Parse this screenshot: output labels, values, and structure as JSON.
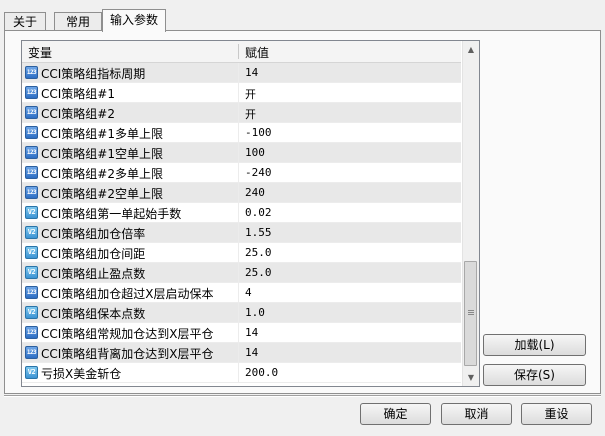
{
  "tabs": [
    {
      "label": "关于"
    },
    {
      "label": "常用"
    },
    {
      "label": "输入参数"
    }
  ],
  "table": {
    "headers": {
      "variable": "变量",
      "value": "赋值"
    },
    "rows": [
      {
        "icon": "123",
        "name": "CCI策略组指标周期",
        "value": "14"
      },
      {
        "icon": "123",
        "name": "CCI策略组#1",
        "value": "开"
      },
      {
        "icon": "123",
        "name": "CCI策略组#2",
        "value": "开"
      },
      {
        "icon": "123",
        "name": "CCI策略组#1多单上限",
        "value": "-100"
      },
      {
        "icon": "123",
        "name": "CCI策略组#1空单上限",
        "value": "100"
      },
      {
        "icon": "123",
        "name": "CCI策略组#2多单上限",
        "value": "-240"
      },
      {
        "icon": "123",
        "name": "CCI策略组#2空单上限",
        "value": "240"
      },
      {
        "icon": "V2",
        "name": "CCI策略组第一单起始手数",
        "value": "0.02"
      },
      {
        "icon": "V2",
        "name": "CCI策略组加仓倍率",
        "value": "1.55"
      },
      {
        "icon": "V2",
        "name": "CCI策略组加仓间距",
        "value": "25.0"
      },
      {
        "icon": "V2",
        "name": "CCI策略组止盈点数",
        "value": "25.0"
      },
      {
        "icon": "123",
        "name": "CCI策略组加仓超过X层启动保本",
        "value": "4"
      },
      {
        "icon": "V2",
        "name": "CCI策略组保本点数",
        "value": "1.0"
      },
      {
        "icon": "123",
        "name": "CCI策略组常规加仓达到X层平仓",
        "value": "14"
      },
      {
        "icon": "123",
        "name": "CCI策略组背离加仓达到X层平仓",
        "value": "14"
      },
      {
        "icon": "V2",
        "name": "亏损X美金斩仓",
        "value": "200.0"
      }
    ]
  },
  "side_buttons": {
    "load": "加载(L)",
    "save": "保存(S)"
  },
  "footer_buttons": {
    "ok": "确定",
    "cancel": "取消",
    "reset": "重设"
  }
}
